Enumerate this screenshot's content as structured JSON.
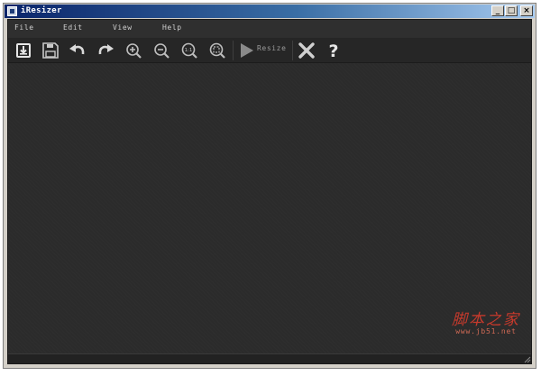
{
  "window": {
    "title": "iResizer"
  },
  "titlebar_buttons": {
    "minimize": "_",
    "maximize": "□",
    "close": "×"
  },
  "menu": [
    "File",
    "Edit",
    "View",
    "Help"
  ],
  "toolbar": {
    "icons": [
      "open-icon",
      "save-icon",
      "undo-icon",
      "redo-icon",
      "zoom-in-icon",
      "zoom-out-icon",
      "zoom-actual-icon",
      "zoom-fit-icon",
      "play-icon",
      "close-icon",
      "help-icon"
    ],
    "zoom_actual_label": "1:1",
    "resize_label": "Resize",
    "help_label": "?"
  },
  "watermark": {
    "main": "脚本之家",
    "sub": "www.jb51.net"
  },
  "colors": {
    "app_bg": "#2b2b2b",
    "toolbar_bg": "#262626",
    "icon": "#d9d9d9",
    "icon_dim": "#8a8a8a",
    "watermark": "#c63a2c"
  }
}
